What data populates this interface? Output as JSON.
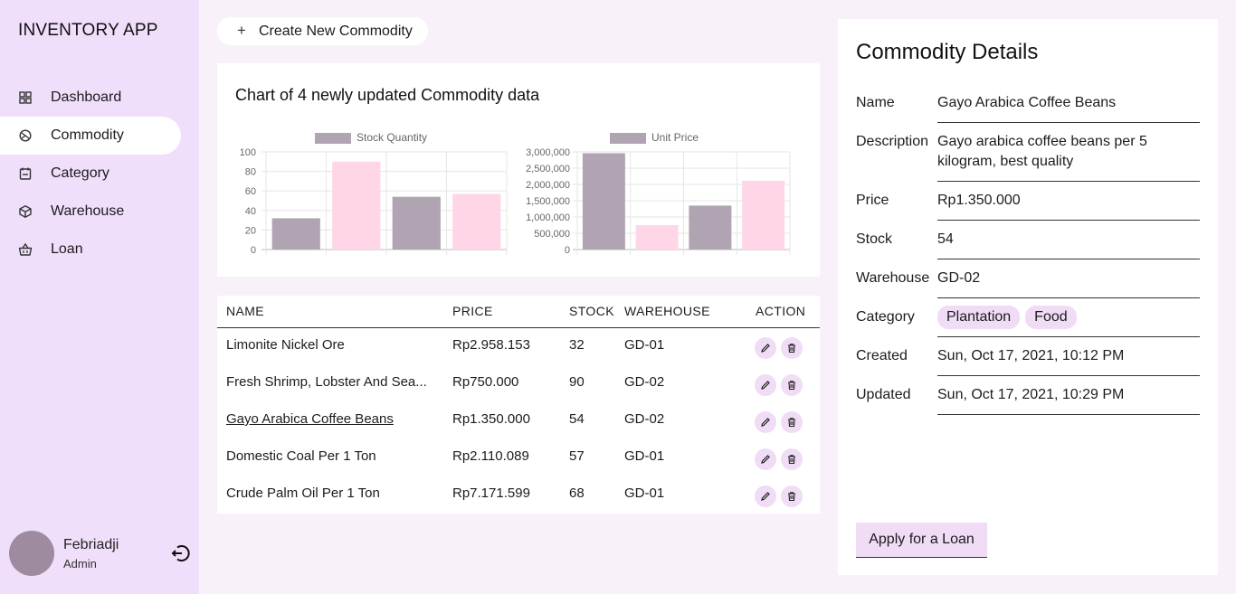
{
  "app": {
    "title": "INVENTORY APP"
  },
  "sidebar": {
    "items": [
      {
        "label": "Dashboard",
        "icon": "dashboard-icon",
        "active": false
      },
      {
        "label": "Commodity",
        "icon": "commodity-icon",
        "active": true
      },
      {
        "label": "Category",
        "icon": "category-icon",
        "active": false
      },
      {
        "label": "Warehouse",
        "icon": "warehouse-icon",
        "active": false
      },
      {
        "label": "Loan",
        "icon": "basket-icon",
        "active": false
      }
    ],
    "user": {
      "name": "Febriadji",
      "role": "Admin"
    }
  },
  "toolbar": {
    "create_label": "Create New Commodity"
  },
  "chart_section": {
    "title": "Chart of 4 newly updated Commodity data"
  },
  "chart_data": [
    {
      "type": "bar",
      "categories": [
        "Limonite Nickel Ore",
        "Fresh Shrimp, Lobster And Sea...",
        "Gayo Arabica Coffee Beans",
        "Domestic Coal Per 1 Ton"
      ],
      "series": [
        {
          "name": "Stock Quantity",
          "values": [
            32,
            90,
            54,
            57
          ]
        }
      ],
      "bar_colors": [
        "#b0a4b2",
        "#ffd6e7",
        "#b0a4b2",
        "#ffd6e7"
      ],
      "ylim": [
        0,
        100
      ],
      "yticks": [
        "100",
        "80",
        "60",
        "40",
        "20",
        "0"
      ],
      "legend": "top"
    },
    {
      "type": "bar",
      "categories": [
        "Limonite Nickel Ore",
        "Fresh Shrimp, Lobster And Sea...",
        "Gayo Arabica Coffee Beans",
        "Domestic Coal Per 1 Ton"
      ],
      "series": [
        {
          "name": "Unit Price",
          "values": [
            2958153,
            750000,
            1350000,
            2110089
          ]
        }
      ],
      "bar_colors": [
        "#b0a4b2",
        "#ffd6e7",
        "#b0a4b2",
        "#ffd6e7"
      ],
      "ylim": [
        0,
        3000000
      ],
      "yticks": [
        "3,000,000",
        "2,500,000",
        "2,000,000",
        "1,500,000",
        "1,000,000",
        "500,000",
        "0"
      ],
      "legend": "top"
    }
  ],
  "table": {
    "headers": {
      "name": "NAME",
      "price": "PRICE",
      "stock": "STOCK",
      "warehouse": "WAREHOUSE",
      "action": "ACTION"
    },
    "rows": [
      {
        "name": "Limonite Nickel Ore",
        "price": "Rp2.958.153",
        "stock": "32",
        "warehouse": "GD-01",
        "selected": false
      },
      {
        "name": "Fresh Shrimp, Lobster And Sea...",
        "price": "Rp750.000",
        "stock": "90",
        "warehouse": "GD-02",
        "selected": false
      },
      {
        "name": "Gayo Arabica Coffee Beans",
        "price": "Rp1.350.000",
        "stock": "54",
        "warehouse": "GD-02",
        "selected": true
      },
      {
        "name": "Domestic Coal Per 1 Ton",
        "price": "Rp2.110.089",
        "stock": "57",
        "warehouse": "GD-01",
        "selected": false
      },
      {
        "name": "Crude Palm Oil Per 1 Ton",
        "price": "Rp7.171.599",
        "stock": "68",
        "warehouse": "GD-01",
        "selected": false
      }
    ]
  },
  "detail": {
    "title": "Commodity Details",
    "labels": {
      "name": "Name",
      "description": "Description",
      "price": "Price",
      "stock": "Stock",
      "warehouse": "Warehouse",
      "category": "Category",
      "created": "Created",
      "updated": "Updated"
    },
    "name": "Gayo Arabica Coffee Beans",
    "description": "Gayo arabica coffee beans per 5 kilogram, best quality",
    "price": "Rp1.350.000",
    "stock": "54",
    "warehouse": "GD-02",
    "categories": [
      "Plantation",
      "Food"
    ],
    "created": "Sun, Oct 17, 2021, 10:12 PM",
    "updated": "Sun, Oct 17, 2021, 10:29 PM",
    "loan_button": "Apply for a Loan"
  },
  "colors": {
    "sidebar_bg": "#f0dffa",
    "page_bg": "#f8f1fa",
    "chip_bg": "#f0dcf5",
    "bar_dark": "#b0a4b2",
    "bar_light": "#ffd6e7"
  }
}
